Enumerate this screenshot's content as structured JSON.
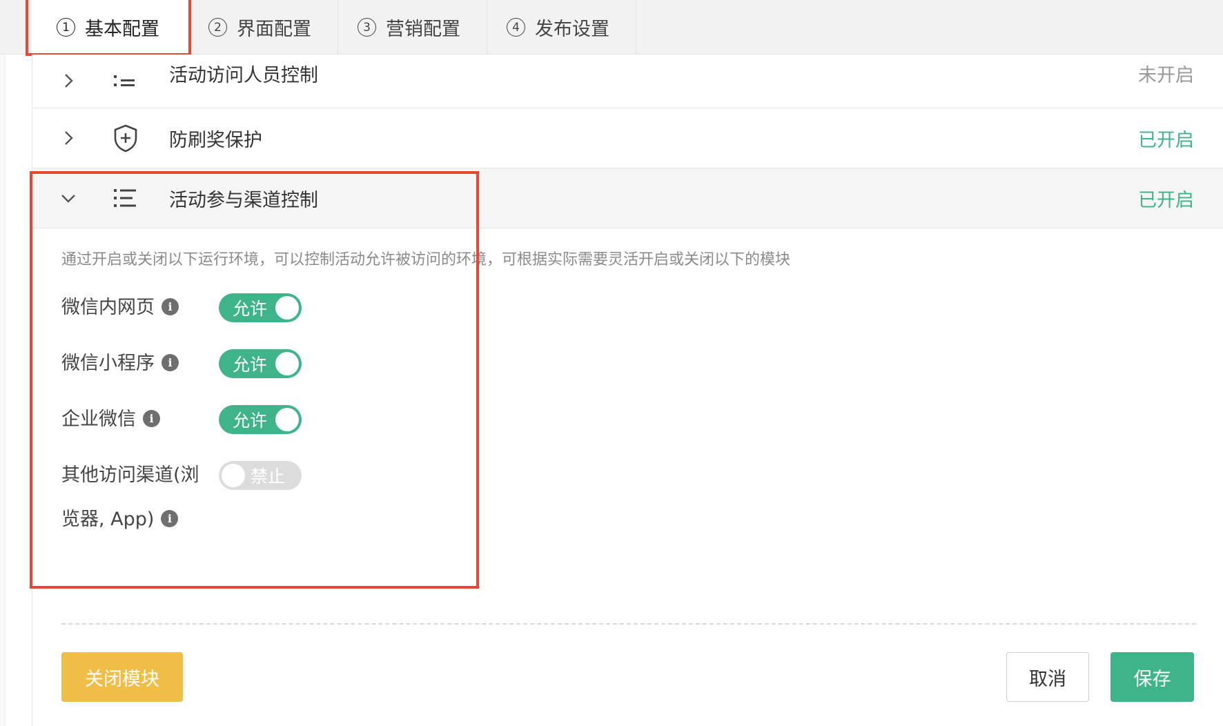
{
  "tabs": [
    {
      "num": "1",
      "label": "基本配置"
    },
    {
      "num": "2",
      "label": "界面配置"
    },
    {
      "num": "3",
      "label": "营销配置"
    },
    {
      "num": "4",
      "label": "发布设置"
    }
  ],
  "rows": [
    {
      "title": "活动访问人员控制",
      "status": "未开启",
      "icon": "list-icon"
    },
    {
      "title": "防刷奖保护",
      "status": "已开启",
      "icon": "shield-plus-icon"
    },
    {
      "title": "活动参与渠道控制",
      "status": "已开启",
      "icon": "list-icon"
    }
  ],
  "section": {
    "description": "通过开启或关闭以下运行环境，可以控制活动允许被访问的环境，可根据实际需要灵活开启或关闭以下的模块",
    "settings": [
      {
        "label": "微信内网页",
        "switch_label": "允许",
        "enabled": true
      },
      {
        "label": "微信小程序",
        "switch_label": "允许",
        "enabled": true
      },
      {
        "label": "企业微信",
        "switch_label": "允许",
        "enabled": true
      },
      {
        "label_line1": "其他访问渠道(浏",
        "label_line2": "览器, App)",
        "switch_label": "禁止",
        "enabled": false
      }
    ]
  },
  "buttons": {
    "close_module": "关闭模块",
    "cancel": "取消",
    "save": "保存"
  },
  "colors": {
    "accent_green": "#3fb48a",
    "warning_yellow": "#f0bd47",
    "highlight_red": "#e24a35"
  }
}
